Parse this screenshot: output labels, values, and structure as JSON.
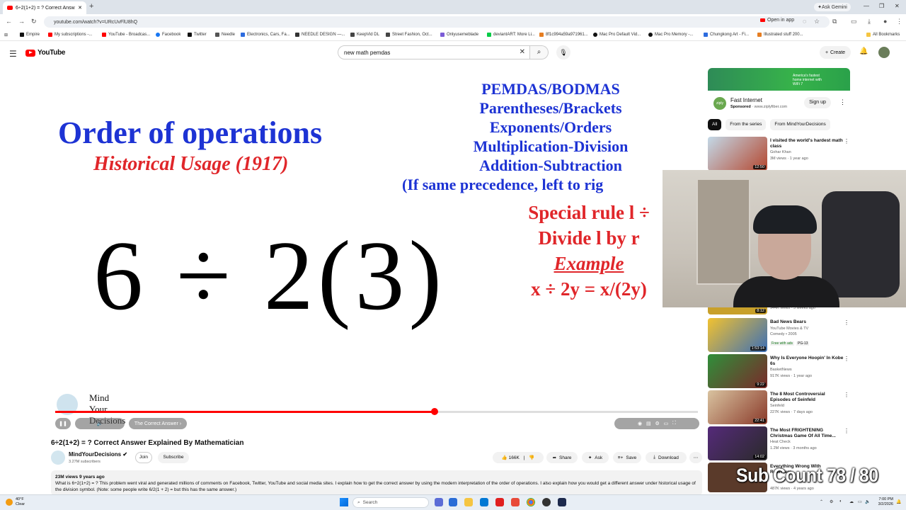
{
  "browser": {
    "tab_title": "6÷2(1+2) = ? Correct Answ...",
    "url": "youtube.com/watch?v=URcUvFlU8hQ",
    "open_in_app": "Open in app",
    "ask_gemini": "Ask Gemini",
    "all_bookmarks": "All Bookmarks",
    "bookmarks": [
      {
        "label": "Empire",
        "color": "#111111"
      },
      {
        "label": "My subscriptions -...",
        "color": "#ff0000"
      },
      {
        "label": "YouTube - Broadcas...",
        "color": "#ff0000"
      },
      {
        "label": "Facebook",
        "color": "#1877f2"
      },
      {
        "label": "Twitter",
        "color": "#111111"
      },
      {
        "label": "Needle",
        "color": "#555555"
      },
      {
        "label": "Electronics, Cars, Fa...",
        "color": "#2d6cdf"
      },
      {
        "label": "NEEDLE DESIGN —...",
        "color": "#333333"
      },
      {
        "label": "KeepVid DL",
        "color": "#444444"
      },
      {
        "label": "Street Fashion, Oct...",
        "color": "#444444"
      },
      {
        "label": "Onlyusemeblade",
        "color": "#7b5cd6"
      },
      {
        "label": "deviantART: More Li...",
        "color": "#05cc47"
      },
      {
        "label": "8f1c994a59a971961...",
        "color": "#e67e22"
      },
      {
        "label": "Mac Pro Default Vid...",
        "color": "#111111"
      },
      {
        "label": "Mac Pro Memory -...",
        "color": "#111111"
      },
      {
        "label": "Chungkong Art - Fi...",
        "color": "#2d6cdf"
      },
      {
        "label": "Illustrated stuff 200...",
        "color": "#e67e22"
      }
    ]
  },
  "youtube": {
    "logo_text": "YouTube",
    "search_value": "new math pemdas",
    "create_label": "Create"
  },
  "video_frame": {
    "title": "Order of operations",
    "subtitle": "Historical Usage (1917)",
    "rules": [
      "PEMDAS/BODMAS",
      "Parentheses/Brackets",
      "Exponents/Orders",
      "Multiplication-Division",
      "Addition-Subtraction",
      "(If same precedence, left to rig"
    ],
    "special_rule": "Special rule l ÷",
    "divide_rule": "Divide l by r",
    "example_label": "Example",
    "example_eq": "x ÷ 2y = x/(2y)",
    "equation": "6 ÷ 2(3)",
    "brand_line1": "Mind",
    "brand_line2": "Your",
    "brand_line3": "Decisions",
    "chapter_label": "The Correct Answer",
    "progress_fraction": 0.59
  },
  "video": {
    "title": "6÷2(1+2) = ? Correct Answer Explained By Mathematician",
    "channel": "MindYourDecisions",
    "subscribers": "3.27M subscribers",
    "join": "Join",
    "subscribe": "Subscribe",
    "likes": "166K",
    "share": "Share",
    "ask": "Ask",
    "save": "Save",
    "download": "Download",
    "desc_meta": "23M views  9 years ago",
    "description": "What is 6÷2(1+2) = ? This problem went viral and generated millions of comments on Facebook, Twitter, YouTube and social media sites. I explain how to get the correct answer by using the modern interpretation of the order of operations. I also explain how you would get a different answer under historical usage of the division symbol. (Note: some people write 6/2(1 + 2) = but this has the same answer.)"
  },
  "ad": {
    "banner_text": "America's fastest home internet with WiFi 7",
    "logo_text": "ziply",
    "title": "Fast Internet",
    "sponsored": "Sponsored",
    "domain": "· www.ziplyfiber.com",
    "signup": "Sign up"
  },
  "chips": [
    "All",
    "From the series",
    "From MindYourDecisions"
  ],
  "related": [
    {
      "title": "I visited the world's hardest math class",
      "channel": "Gohar Khan",
      "meta": "3M views · 1 year ago",
      "duration": "12:50",
      "thumb": "#b5472f"
    },
    {
      "title": "",
      "channel": "",
      "meta": "944K views · 3 weeks ago",
      "duration": "8:12",
      "thumb": "#c8a02a"
    },
    {
      "title": "Bad News Bears",
      "channel": "YouTube Movies & TV",
      "meta": "Comedy • 2005",
      "duration": "1:53:14",
      "thumb": "#3c6fb5",
      "free": "Free with ads",
      "rating": "PG-13"
    },
    {
      "title": "Why Is Everyone Hoopin' In Kobe 6s",
      "channel": "BasketNews",
      "meta": "917K views · 1 year ago",
      "duration": "9:22",
      "thumb": "#2f8f3a"
    },
    {
      "title": "The 8 Most Controversial Episodes of Seinfeld",
      "channel": "Seinfeld",
      "meta": "227K views · 7 days ago",
      "duration": "22:41",
      "thumb": "#8a3a2a"
    },
    {
      "title": "The Most FRIGHTENING Christmas Game Of All Time...",
      "channel": "Heat Check",
      "meta": "1.2M views · 3 months ago",
      "duration": "14:02",
      "thumb": "#2a2a2a"
    },
    {
      "title": "Everything Wrong With Rounders...",
      "channel": "CinemaSins",
      "meta": "487K views · 4 years ago",
      "duration": "",
      "thumb": "#5a3a2a"
    }
  ],
  "overlay": {
    "sub_count": "Sub Count 78 / 80"
  },
  "taskbar": {
    "temp": "40°F",
    "weather": "Clear",
    "search_placeholder": "Search",
    "time": "7:00 PM",
    "date": "3/2/2026"
  }
}
